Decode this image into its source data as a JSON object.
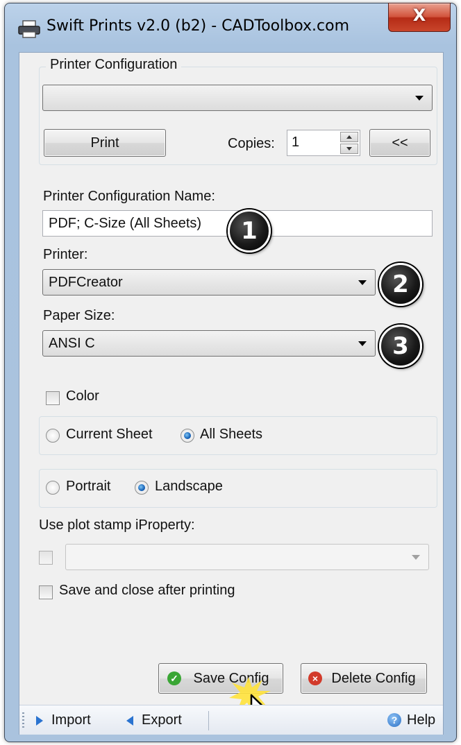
{
  "window": {
    "title": "Swift Prints v2.0 (b2) - CADToolbox.com",
    "close_glyph": "X",
    "title_icon": "printer-icon"
  },
  "printer_configuration_group": {
    "legend": "Printer Configuration",
    "selected_config": "",
    "print_button": "Print",
    "copies_label": "Copies:",
    "copies_value": "1",
    "collapse_button": "<<"
  },
  "config_form": {
    "name_label": "Printer Configuration Name:",
    "name_value": "PDF; C-Size (All Sheets)",
    "printer_label": "Printer:",
    "printer_value": "PDFCreator",
    "paper_size_label": "Paper Size:",
    "paper_size_value": "ANSI C"
  },
  "callouts": [
    "1",
    "2",
    "3"
  ],
  "options": {
    "color_label": "Color",
    "color_checked": false,
    "sheets": {
      "current_label": "Current Sheet",
      "all_label": "All Sheets",
      "selected": "All Sheets"
    },
    "orientation": {
      "portrait_label": "Portrait",
      "landscape_label": "Landscape",
      "selected": "Landscape"
    },
    "plot_stamp_label": "Use plot stamp iProperty:",
    "plot_stamp_checked": false,
    "plot_stamp_value": "",
    "save_close_label": "Save and close after printing",
    "save_close_checked": false
  },
  "actions": {
    "save_config": "Save Config",
    "delete_config": "Delete Config"
  },
  "toolbar": {
    "import_label": "Import",
    "export_label": "Export",
    "help_label": "Help"
  },
  "colors": {
    "accent_blue": "#2a73d0",
    "save_icon_green": "#3aa635",
    "delete_icon_red": "#d23a2a",
    "close_red": "#c9452b"
  }
}
